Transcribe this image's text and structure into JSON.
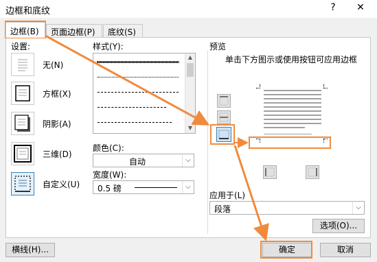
{
  "window": {
    "title": "边框和底纹",
    "help": "?",
    "close": "✕"
  },
  "tabs": [
    {
      "label": "边框(B)"
    },
    {
      "label": "页面边框(P)"
    },
    {
      "label": "底纹(S)"
    }
  ],
  "settings": {
    "title": "设置:",
    "items": [
      {
        "label": "无(N)",
        "icon": "border-none-icon"
      },
      {
        "label": "方框(X)",
        "icon": "border-box-icon"
      },
      {
        "label": "阴影(A)",
        "icon": "border-shadow-icon"
      },
      {
        "label": "三维(D)",
        "icon": "border-3d-icon"
      },
      {
        "label": "自定义(U)",
        "icon": "border-custom-icon",
        "selected": true
      }
    ]
  },
  "style": {
    "title": "样式(Y):",
    "options": [
      "solid",
      "dotted",
      "dashed-small",
      "dashed",
      "dash-dot"
    ],
    "selected": "solid"
  },
  "color": {
    "label": "颜色(C):",
    "value": "自动"
  },
  "width": {
    "label": "宽度(W):",
    "value": "0.5 磅"
  },
  "preview": {
    "title": "预览",
    "hint": "单击下方图示或使用按钮可应用边框"
  },
  "apply_to": {
    "label": "应用于(L)",
    "value": "段落"
  },
  "buttons": {
    "options": "选项(O)...",
    "horizontal_line": "横线(H)...",
    "ok": "确定",
    "cancel": "取消"
  },
  "annotation_color": "#f08a3c"
}
